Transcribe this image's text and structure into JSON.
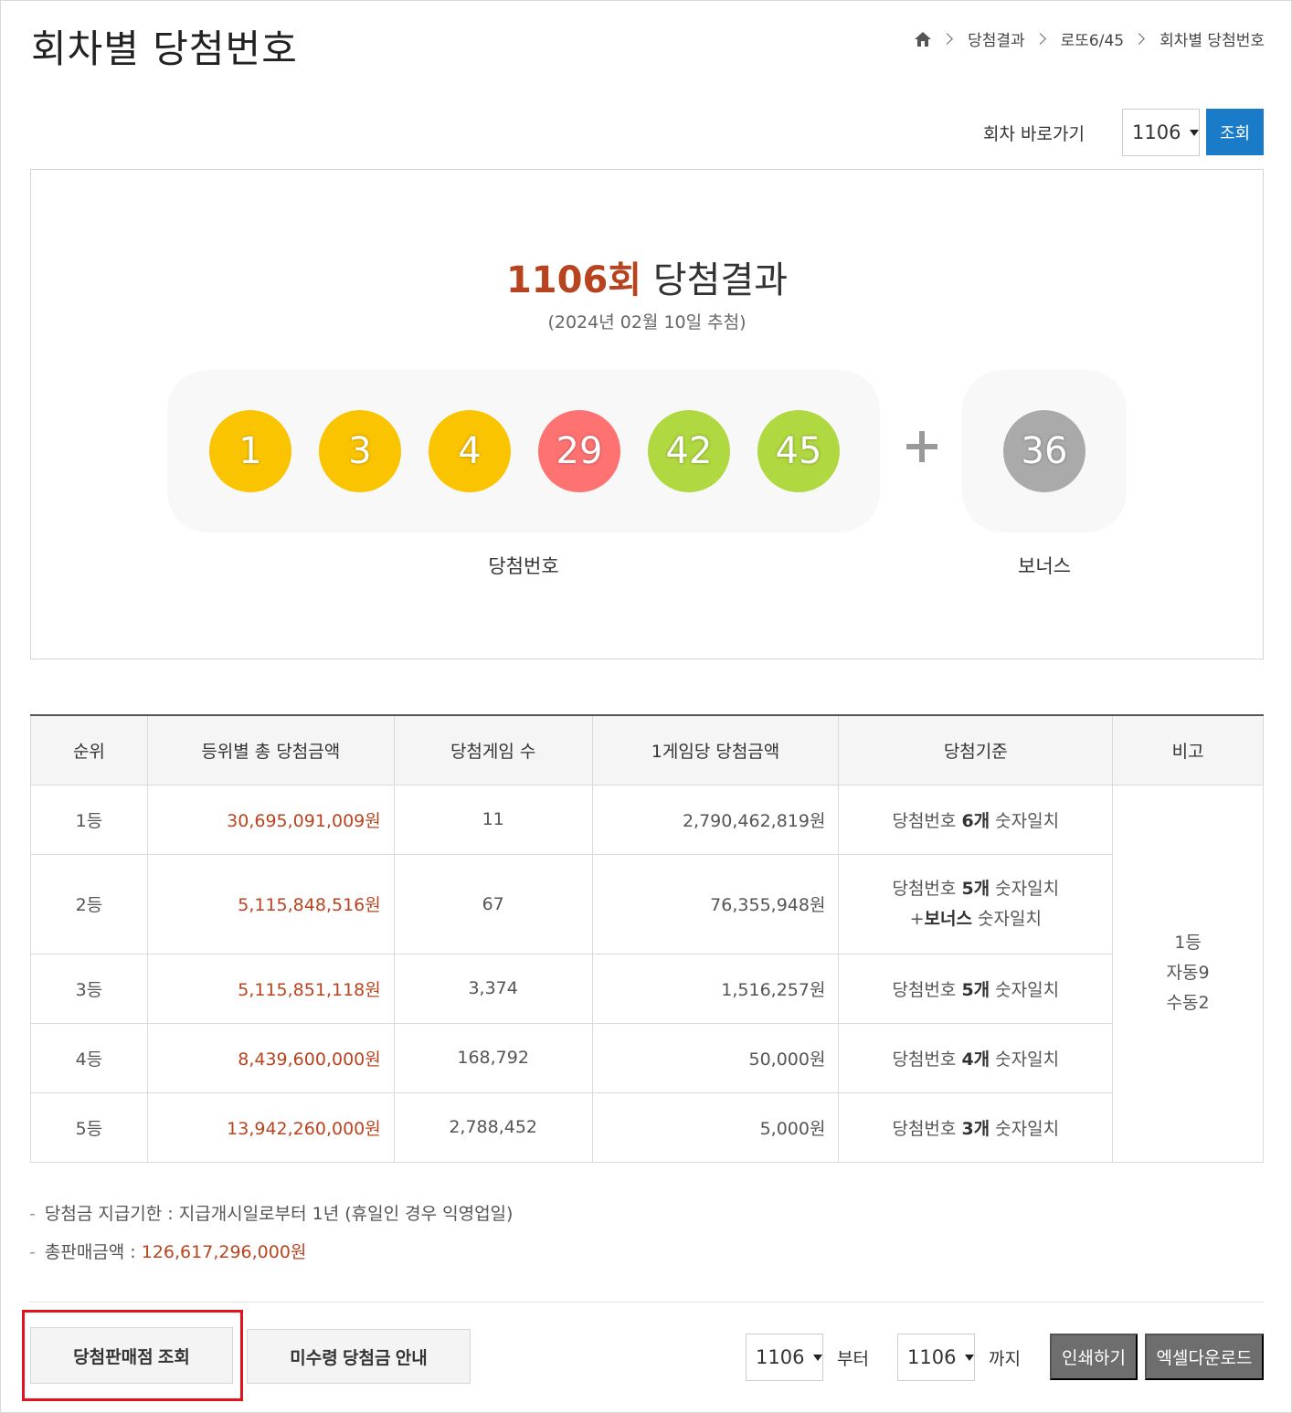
{
  "header": {
    "title": "회차별 당첨번호",
    "breadcrumb": [
      "당첨결과",
      "로또6/45",
      "회차별 당첨번호"
    ]
  },
  "goto": {
    "label": "회차 바로가기",
    "selected_round": "1106",
    "search_button": "조회"
  },
  "result": {
    "round_label": "1106회",
    "title_suffix": "당첨결과",
    "draw_date": "(2024년 02월 10일 추첨)",
    "numbers": [
      "1",
      "3",
      "4",
      "29",
      "42",
      "45"
    ],
    "number_colors": [
      "#fbc400",
      "#fbc400",
      "#fbc400",
      "#ff7272",
      "#b0d840",
      "#b0d840"
    ],
    "bonus": "36",
    "bonus_color": "#aaaaaa",
    "numbers_label": "당첨번호",
    "bonus_label": "보너스"
  },
  "table": {
    "headers": [
      "순위",
      "등위별 총 당첨금액",
      "당첨게임 수",
      "1게임당 당첨금액",
      "당첨기준",
      "비고"
    ],
    "rows": [
      {
        "rank": "1등",
        "total": "30,695,091,009원",
        "games": "11",
        "per_game": "2,790,462,819원",
        "std_pre": "당첨번호 ",
        "std_bold": "6개",
        "std_post": " 숫자일치",
        "std2_bold": "",
        "std2_post": ""
      },
      {
        "rank": "2등",
        "total": "5,115,848,516원",
        "games": "67",
        "per_game": "76,355,948원",
        "std_pre": "당첨번호 ",
        "std_bold": "5개",
        "std_post": " 숫자일치",
        "std2_pre": "+",
        "std2_bold": "보너스",
        "std2_post": " 숫자일치"
      },
      {
        "rank": "3등",
        "total": "5,115,851,118원",
        "games": "3,374",
        "per_game": "1,516,257원",
        "std_pre": "당첨번호 ",
        "std_bold": "5개",
        "std_post": " 숫자일치"
      },
      {
        "rank": "4등",
        "total": "8,439,600,000원",
        "games": "168,792",
        "per_game": "50,000원",
        "std_pre": "당첨번호 ",
        "std_bold": "4개",
        "std_post": " 숫자일치"
      },
      {
        "rank": "5등",
        "total": "13,942,260,000원",
        "games": "2,788,452",
        "per_game": "5,000원",
        "std_pre": "당첨번호 ",
        "std_bold": "3개",
        "std_post": " 숫자일치"
      }
    ],
    "note": [
      "1등",
      "자동9",
      "수동2"
    ]
  },
  "info": {
    "dash": "-",
    "deadline": "당첨금 지급기한 : 지급개시일로부터 1년 (휴일인 경우 익영업일)",
    "sales_label": "총판매금액 : ",
    "sales_value": "126,617,296,000원"
  },
  "footer": {
    "store_button": "당첨판매점 조회",
    "unclaimed_button": "미수령 당첨금 안내",
    "from_round": "1106",
    "from_label": "부터",
    "to_round": "1106",
    "to_label": "까지",
    "print_button": "인쇄하기",
    "excel_button": "엑셀다운로드"
  }
}
